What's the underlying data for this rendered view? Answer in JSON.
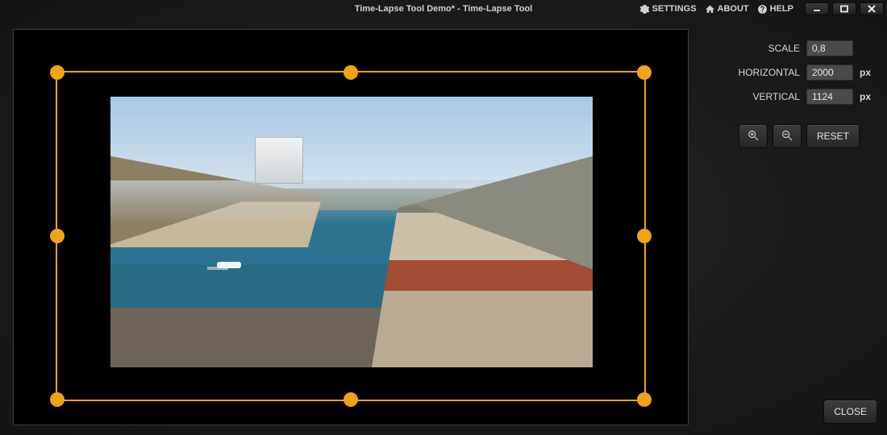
{
  "window": {
    "title": "Time-Lapse Tool Demo* - Time-Lapse Tool"
  },
  "menu": {
    "settings": {
      "label": "SETTINGS",
      "icon": "gear-icon"
    },
    "about": {
      "label": "ABOUT",
      "icon": "home-icon"
    },
    "help": {
      "label": "HELP",
      "icon": "help-icon"
    }
  },
  "controls": {
    "scale": {
      "label": "SCALE",
      "value": "0,8",
      "unit": ""
    },
    "horizontal": {
      "label": "HORIZONTAL",
      "value": "2000",
      "unit": "px"
    },
    "vertical": {
      "label": "VERTICAL",
      "value": "1124",
      "unit": "px"
    },
    "zoom_in": {
      "icon": "zoom-in-icon"
    },
    "zoom_out": {
      "icon": "zoom-out-icon"
    },
    "reset": {
      "label": "RESET"
    },
    "close": {
      "label": "CLOSE"
    }
  }
}
